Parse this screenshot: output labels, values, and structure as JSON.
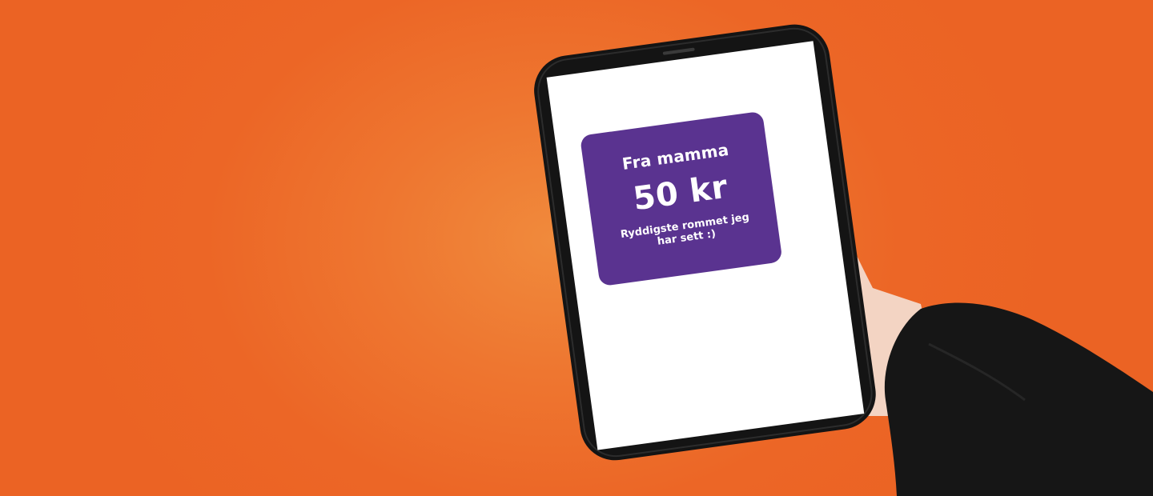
{
  "colors": {
    "background": "#ec6626",
    "card": "#5a3390",
    "card_text": "#ffffff",
    "phone_body": "#141414",
    "screen": "#ffffff",
    "sleeve": "#151515",
    "skin": "#f3d2c0"
  },
  "message": {
    "from": "Fra mamma",
    "amount": "50 kr",
    "note": "Ryddigste rommet jeg har sett :)"
  }
}
